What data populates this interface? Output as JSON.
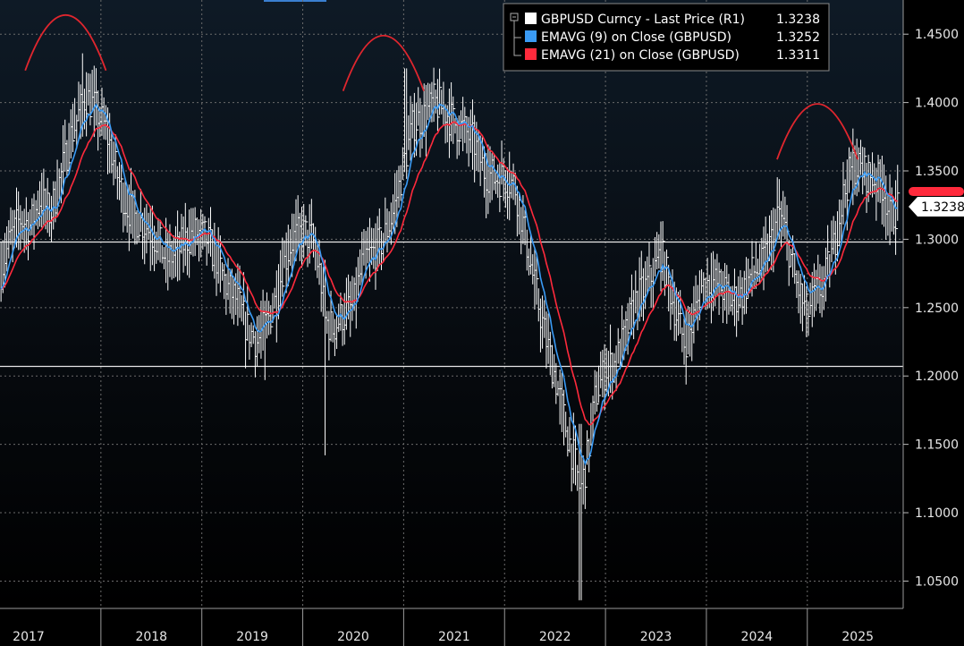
{
  "chart_data": {
    "type": "line",
    "legend": {
      "placement": "top-right",
      "entries": [
        {
          "label": "GBPUSD Curncy - Last Price (R1)",
          "value": "1.3238",
          "color": "#ffffff"
        },
        {
          "label": "EMAVG (9)  on Close (GBPUSD)",
          "value": "1.3252",
          "color": "#3a9bf5"
        },
        {
          "label": "EMAVG (21)  on Close (GBPUSD)",
          "value": "1.3311",
          "color": "#ff2a3c"
        }
      ]
    },
    "last_price_label": "1.3238",
    "ylim": [
      1.03,
      1.475
    ],
    "yticks": [
      "1.0500",
      "1.1000",
      "1.1500",
      "1.2000",
      "1.2500",
      "1.3000",
      "1.3500",
      "1.4000",
      "1.4500"
    ],
    "xlim": [
      2017.0,
      2025.95
    ],
    "xticks": [
      "2017",
      "2018",
      "2019",
      "2020",
      "2021",
      "2022",
      "2023",
      "2024",
      "2025"
    ],
    "grid": true,
    "horizontal_levels": [
      1.298,
      1.207
    ],
    "arcs": [
      {
        "x_start": 2017.25,
        "x_end": 2018.05,
        "peak": 1.464
      },
      {
        "x_start": 2020.4,
        "x_end": 2021.2,
        "peak": 1.449
      },
      {
        "x_start": 2024.7,
        "x_end": 2025.5,
        "peak": 1.399
      }
    ],
    "price_path": [
      [
        2017.0,
        1.275
      ],
      [
        2017.1,
        1.3
      ],
      [
        2017.2,
        1.315
      ],
      [
        2017.3,
        1.31
      ],
      [
        2017.4,
        1.33
      ],
      [
        2017.5,
        1.318
      ],
      [
        2017.6,
        1.345
      ],
      [
        2017.7,
        1.375
      ],
      [
        2017.8,
        1.395
      ],
      [
        2017.85,
        1.405
      ],
      [
        2017.95,
        1.395
      ],
      [
        2018.05,
        1.38
      ],
      [
        2018.15,
        1.35
      ],
      [
        2018.25,
        1.325
      ],
      [
        2018.35,
        1.315
      ],
      [
        2018.45,
        1.31
      ],
      [
        2018.55,
        1.3
      ],
      [
        2018.65,
        1.285
      ],
      [
        2018.75,
        1.29
      ],
      [
        2018.85,
        1.3
      ],
      [
        2018.95,
        1.305
      ],
      [
        2019.05,
        1.3
      ],
      [
        2019.15,
        1.285
      ],
      [
        2019.25,
        1.265
      ],
      [
        2019.35,
        1.255
      ],
      [
        2019.45,
        1.235
      ],
      [
        2019.55,
        1.225
      ],
      [
        2019.65,
        1.24
      ],
      [
        2019.75,
        1.26
      ],
      [
        2019.8,
        1.28
      ],
      [
        2019.9,
        1.3
      ],
      [
        2020.0,
        1.305
      ],
      [
        2020.1,
        1.3
      ],
      [
        2020.18,
        1.27
      ],
      [
        2020.22,
        1.24
      ],
      [
        2020.3,
        1.235
      ],
      [
        2020.4,
        1.245
      ],
      [
        2020.5,
        1.25
      ],
      [
        2020.6,
        1.285
      ],
      [
        2020.7,
        1.29
      ],
      [
        2020.8,
        1.3
      ],
      [
        2020.9,
        1.32
      ],
      [
        2021.0,
        1.355
      ],
      [
        2021.1,
        1.385
      ],
      [
        2021.2,
        1.39
      ],
      [
        2021.3,
        1.4
      ],
      [
        2021.4,
        1.395
      ],
      [
        2021.5,
        1.385
      ],
      [
        2021.6,
        1.38
      ],
      [
        2021.7,
        1.37
      ],
      [
        2021.8,
        1.35
      ],
      [
        2021.9,
        1.345
      ],
      [
        2022.0,
        1.345
      ],
      [
        2022.1,
        1.34
      ],
      [
        2022.2,
        1.305
      ],
      [
        2022.3,
        1.265
      ],
      [
        2022.4,
        1.23
      ],
      [
        2022.5,
        1.2
      ],
      [
        2022.6,
        1.165
      ],
      [
        2022.7,
        1.135
      ],
      [
        2022.75,
        1.115
      ],
      [
        2022.82,
        1.14
      ],
      [
        2022.9,
        1.185
      ],
      [
        2023.0,
        1.205
      ],
      [
        2023.1,
        1.21
      ],
      [
        2023.2,
        1.23
      ],
      [
        2023.3,
        1.255
      ],
      [
        2023.4,
        1.265
      ],
      [
        2023.5,
        1.28
      ],
      [
        2023.55,
        1.29
      ],
      [
        2023.62,
        1.27
      ],
      [
        2023.7,
        1.245
      ],
      [
        2023.78,
        1.225
      ],
      [
        2023.85,
        1.235
      ],
      [
        2023.95,
        1.265
      ],
      [
        2024.05,
        1.27
      ],
      [
        2024.15,
        1.265
      ],
      [
        2024.25,
        1.255
      ],
      [
        2024.35,
        1.26
      ],
      [
        2024.45,
        1.275
      ],
      [
        2024.55,
        1.28
      ],
      [
        2024.65,
        1.3
      ],
      [
        2024.72,
        1.32
      ],
      [
        2024.8,
        1.3
      ],
      [
        2024.88,
        1.27
      ],
      [
        2024.95,
        1.255
      ],
      [
        2025.0,
        1.245
      ],
      [
        2025.08,
        1.26
      ],
      [
        2025.15,
        1.265
      ],
      [
        2025.25,
        1.29
      ],
      [
        2025.35,
        1.33
      ],
      [
        2025.45,
        1.355
      ],
      [
        2025.55,
        1.35
      ],
      [
        2025.65,
        1.345
      ],
      [
        2025.75,
        1.34
      ],
      [
        2025.82,
        1.315
      ],
      [
        2025.86,
        1.32
      ],
      [
        2025.9,
        1.324
      ]
    ]
  }
}
